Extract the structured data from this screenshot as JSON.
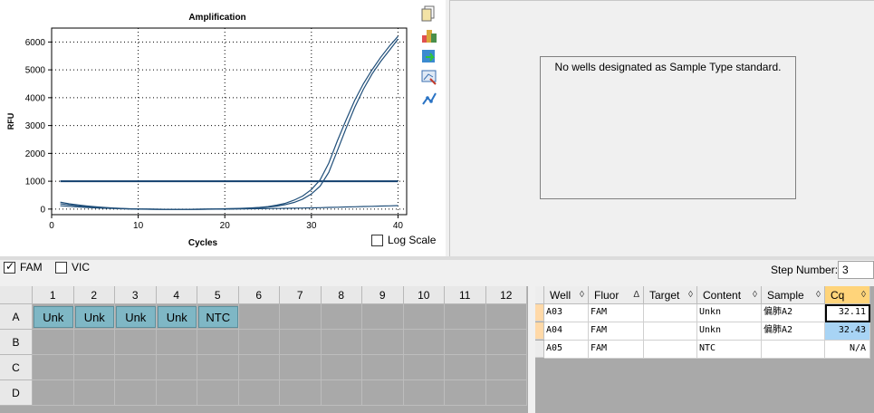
{
  "chart_data": {
    "type": "line",
    "title": "Amplification",
    "xlabel": "Cycles",
    "ylabel": "RFU",
    "xlim": [
      0,
      41
    ],
    "ylim": [
      -200,
      6500
    ],
    "xticks": [
      0,
      10,
      20,
      30,
      40
    ],
    "yticks": [
      0,
      1000,
      2000,
      3000,
      4000,
      5000,
      6000
    ],
    "grid": true,
    "threshold": 1000,
    "series": [
      {
        "x": [
          1,
          2,
          3,
          4,
          5,
          6,
          7,
          8,
          9,
          10,
          11,
          12,
          13,
          14,
          15,
          16,
          17,
          18,
          19,
          20,
          21,
          22,
          23,
          24,
          25,
          26,
          27,
          28,
          29,
          30,
          31,
          32,
          33,
          34,
          35,
          36,
          37,
          38,
          39,
          40
        ],
        "y": [
          250,
          190,
          150,
          115,
          85,
          60,
          40,
          25,
          12,
          5,
          0,
          -5,
          -8,
          -10,
          -10,
          -8,
          -5,
          0,
          5,
          10,
          18,
          28,
          40,
          60,
          90,
          140,
          210,
          320,
          470,
          700,
          1050,
          1650,
          2450,
          3200,
          3900,
          4500,
          5000,
          5450,
          5850,
          6200
        ]
      },
      {
        "x": [
          1,
          2,
          3,
          4,
          5,
          6,
          7,
          8,
          9,
          10,
          11,
          12,
          13,
          14,
          15,
          16,
          17,
          18,
          19,
          20,
          21,
          22,
          23,
          24,
          25,
          26,
          27,
          28,
          29,
          30,
          31,
          32,
          33,
          34,
          35,
          36,
          37,
          38,
          39,
          40
        ],
        "y": [
          190,
          150,
          120,
          90,
          65,
          45,
          30,
          18,
          8,
          2,
          -3,
          -6,
          -9,
          -10,
          -10,
          -9,
          -6,
          -2,
          3,
          8,
          14,
          22,
          32,
          48,
          70,
          105,
          160,
          240,
          360,
          540,
          820,
          1320,
          2100,
          2900,
          3650,
          4300,
          4850,
          5300,
          5700,
          6100
        ]
      },
      {
        "x": [
          1,
          2,
          3,
          4,
          5,
          6,
          7,
          8,
          9,
          10,
          11,
          12,
          13,
          14,
          15,
          16,
          17,
          18,
          19,
          20,
          21,
          22,
          23,
          24,
          25,
          26,
          27,
          28,
          29,
          30,
          31,
          32,
          33,
          34,
          35,
          36,
          37,
          38,
          39,
          40
        ],
        "y": [
          120,
          100,
          80,
          60,
          45,
          30,
          20,
          10,
          4,
          0,
          -4,
          -7,
          -9,
          -10,
          -10,
          -9,
          -7,
          -5,
          -3,
          0,
          3,
          6,
          10,
          14,
          18,
          22,
          27,
          32,
          38,
          45,
          52,
          60,
          68,
          76,
          84,
          92,
          100,
          108,
          116,
          124
        ]
      }
    ]
  },
  "toolbar": {
    "icons": [
      "copy-icon",
      "palette-icon",
      "export-icon",
      "zoom-chart-icon",
      "trend-icon"
    ]
  },
  "chart_panel": {
    "log_scale_label": "Log Scale",
    "log_scale_checked": false
  },
  "standard_curve": {
    "message": "No wells designated as Sample Type standard."
  },
  "fluor": {
    "options": [
      {
        "label": "FAM",
        "checked": true
      },
      {
        "label": "VIC",
        "checked": false
      }
    ],
    "step_label": "Step Number:",
    "step_value": "3"
  },
  "plate": {
    "columns": [
      "1",
      "2",
      "3",
      "4",
      "5",
      "6",
      "7",
      "8",
      "9",
      "10",
      "11",
      "12"
    ],
    "rows": [
      "A",
      "B",
      "C",
      "D"
    ],
    "wells": [
      {
        "row": "A",
        "col": 1,
        "label": "Unk"
      },
      {
        "row": "A",
        "col": 2,
        "label": "Unk"
      },
      {
        "row": "A",
        "col": 3,
        "label": "Unk"
      },
      {
        "row": "A",
        "col": 4,
        "label": "Unk"
      },
      {
        "row": "A",
        "col": 5,
        "label": "NTC"
      }
    ]
  },
  "table": {
    "headers": [
      {
        "label": "Well",
        "sort": "◊"
      },
      {
        "label": "Fluor",
        "sort": "Δ"
      },
      {
        "label": "Target",
        "sort": "◊"
      },
      {
        "label": "Content",
        "sort": "◊"
      },
      {
        "label": "Sample",
        "sort": "◊"
      },
      {
        "label": "Cq",
        "sort": "◊"
      }
    ],
    "rows": [
      {
        "well": "A03",
        "fluor": "FAM",
        "target": "",
        "content": "Unkn",
        "sample": "偏肺A2",
        "cq": "32.11"
      },
      {
        "well": "A04",
        "fluor": "FAM",
        "target": "",
        "content": "Unkn",
        "sample": "偏肺A2",
        "cq": "32.43"
      },
      {
        "well": "A05",
        "fluor": "FAM",
        "target": "",
        "content": "NTC",
        "sample": "",
        "cq": "N/A"
      }
    ]
  },
  "colors": {
    "curve": "#1f4e79",
    "threshold": "#123f6e",
    "well": "#7fb7c5",
    "sort_active": "#ffd47a"
  }
}
